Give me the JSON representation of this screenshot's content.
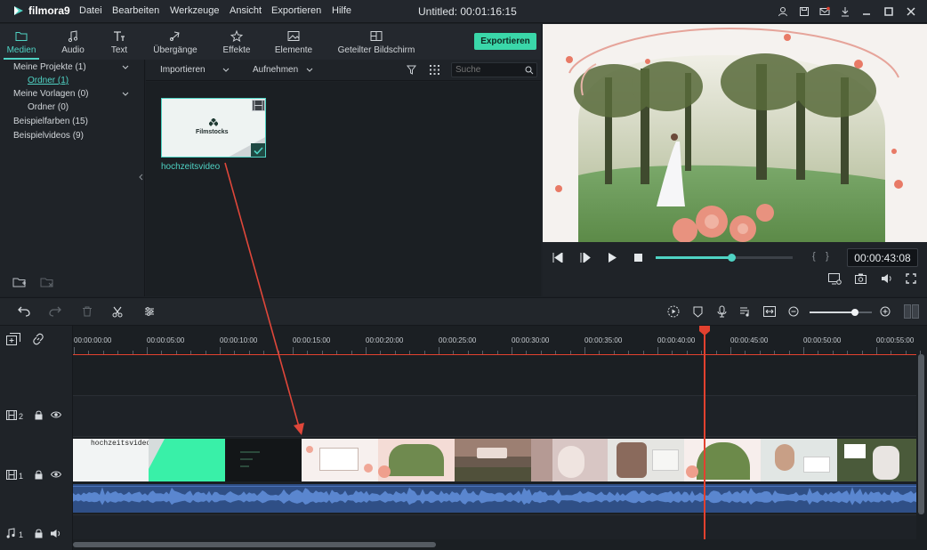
{
  "app": {
    "logo_text": "filmora9",
    "title": "Untitled:",
    "duration": "00:01:16:15"
  },
  "menu": [
    "Datei",
    "Bearbeiten",
    "Werkzeuge",
    "Ansicht",
    "Exportieren",
    "Hilfe"
  ],
  "tabs": [
    {
      "label": "Medien",
      "icon": "folder-icon",
      "active": true
    },
    {
      "label": "Audio",
      "icon": "music-note-icon"
    },
    {
      "label": "Text",
      "icon": "text-icon"
    },
    {
      "label": "Übergänge",
      "icon": "transition-icon"
    },
    {
      "label": "Effekte",
      "icon": "effects-icon"
    },
    {
      "label": "Elemente",
      "icon": "image-icon"
    },
    {
      "label": "Geteilter Bildschirm",
      "icon": "split-screen-icon"
    }
  ],
  "export_label": "Exportieren",
  "tree": [
    {
      "label": "Meine Projekte (1)"
    },
    {
      "label": "Ordner (1)",
      "selected": true
    },
    {
      "label": "Meine Vorlagen (0)"
    },
    {
      "label": "Ordner (0)"
    },
    {
      "label": "Beispielfarben (15)"
    },
    {
      "label": "Beispielvideos (9)"
    }
  ],
  "media": {
    "import_label": "Importieren",
    "record_label": "Aufnehmen",
    "search_placeholder": "Suche",
    "thumb_logo": "Filmstocks",
    "thumb_name": "hochzeitsvideo"
  },
  "preview": {
    "timecode": "00:00:43:08",
    "progress": 0.55
  },
  "ruler": [
    "00:00:00:00",
    "00:00:05:00",
    "00:00:10:00",
    "00:00:15:00",
    "00:00:20:00",
    "00:00:25:00",
    "00:00:30:00",
    "00:00:35:00",
    "00:00:40:00",
    "00:00:45:00",
    "00:00:50:00",
    "00:00:55:00"
  ],
  "tracks": {
    "track2": "2",
    "track1": "1",
    "audio": "1"
  },
  "clip_title": "hochzeitsvideo",
  "zoom_level": 0.73,
  "colors": {
    "accent": "#4fd3c4",
    "playhead": "#e2412f",
    "export": "#3ad7a9",
    "clip_green": "#39f0a8",
    "audio": "#3d64a8"
  }
}
